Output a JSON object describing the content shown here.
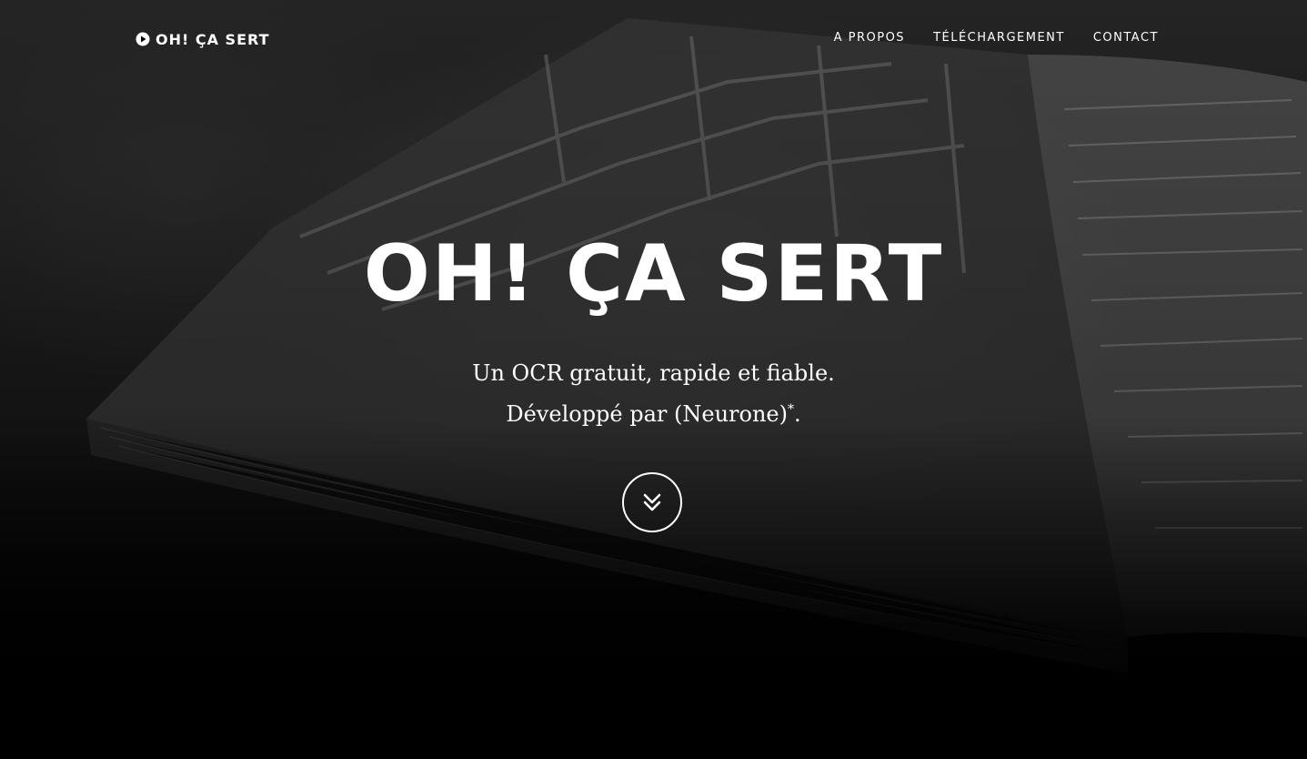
{
  "navbar": {
    "brand": "OH! ÇA SERT",
    "brand_icon": "play-circle-icon",
    "links": [
      "A PROPOS",
      "TÉLÉCHARGEMENT",
      "CONTACT"
    ]
  },
  "hero": {
    "title": "OH! ÇA SERT",
    "line1": "Un OCR gratuit, rapide et fiable.",
    "line2_before": "Développé par (Neurone)",
    "line2_sup": "*",
    "line2_after": ".",
    "scroll_icon": "double-chevron-down-icon"
  },
  "colors": {
    "text": "#ffffff",
    "background": "#000000"
  }
}
